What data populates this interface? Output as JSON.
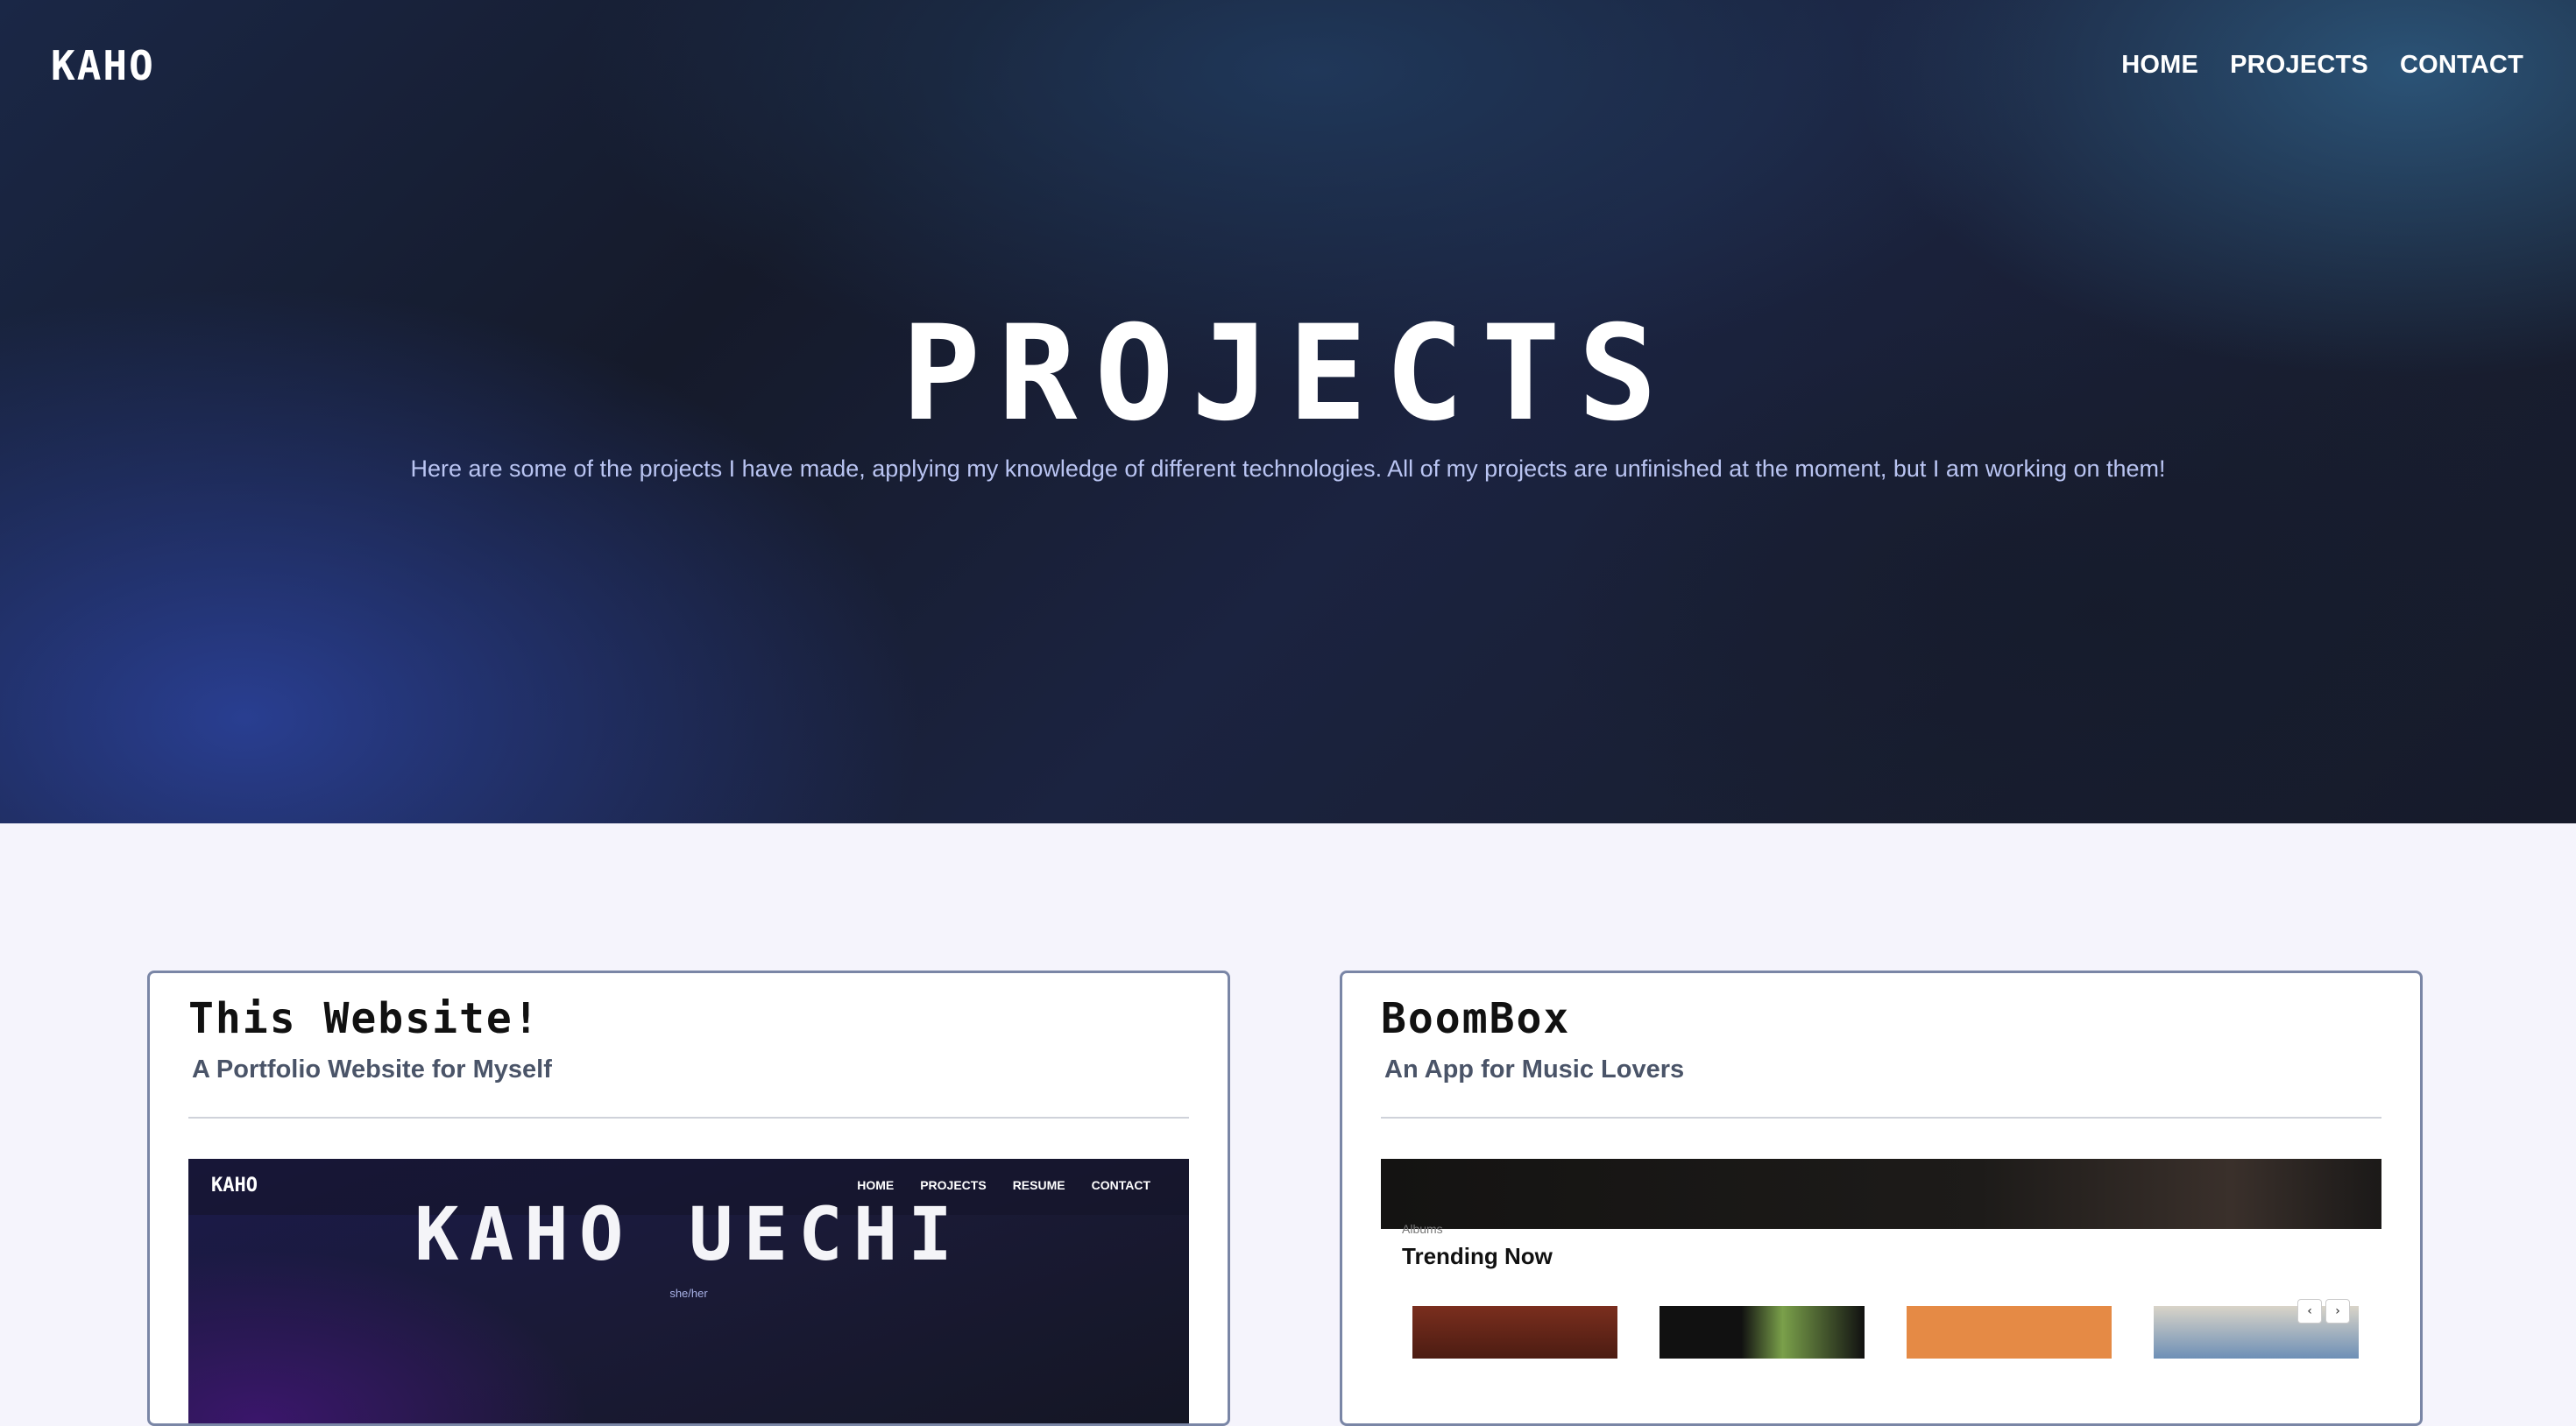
{
  "header": {
    "brand": "KAHO",
    "nav": [
      "HOME",
      "PROJECTS",
      "CONTACT"
    ]
  },
  "hero": {
    "title": "PROJECTS",
    "subtitle": "Here are some of the projects I have made, applying my knowledge of different technologies. All of my projects are unfinished at the moment, but I am working on them!"
  },
  "projects": [
    {
      "title": "This Website!",
      "subtitle": "A Portfolio Website for Myself",
      "preview": {
        "brand": "KAHO",
        "nav": [
          "HOME",
          "PROJECTS",
          "RESUME",
          "CONTACT"
        ],
        "heading": "KAHO UECHI",
        "pronouns": "she/her"
      }
    },
    {
      "title": "BoomBox",
      "subtitle": "An App for Music Lovers",
      "preview": {
        "section_label": "Albums",
        "section_heading": "Trending Now",
        "prev": "‹",
        "next": "›"
      }
    }
  ],
  "colors": {
    "hero_dark": "#161a2a",
    "hero_blue": "#2a4096",
    "subtitle": "#b9c4f2",
    "page_bg": "#f5f4fc",
    "card_border": "#7a86a6"
  }
}
